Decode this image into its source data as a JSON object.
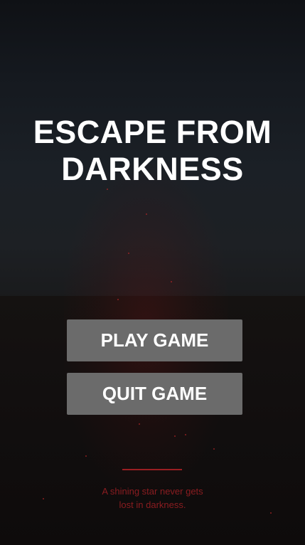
{
  "game": {
    "title_line1": "ESCAPE FROM",
    "title_line2": "DARKNESS"
  },
  "menu": {
    "play_label": "PLAY GAME",
    "quit_label": "QUIT GAME"
  },
  "footer": {
    "quote_line1": "A shining star never gets",
    "quote_line2": "lost in darkness."
  },
  "colors": {
    "button_bg": "#6b6b6b",
    "button_text": "#ffffff",
    "accent_red": "#9a1e22",
    "quote_text": "#8a1c20"
  }
}
